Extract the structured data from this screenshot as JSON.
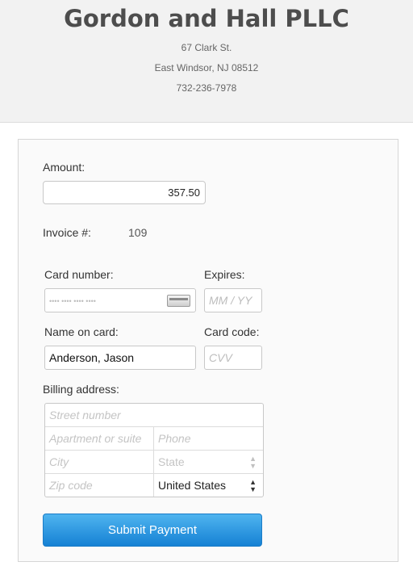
{
  "header": {
    "company": "Gordon and Hall PLLC",
    "street": "67 Clark St.",
    "city_line": "East Windsor, NJ 08512",
    "phone": "732-236-7978"
  },
  "form": {
    "amount_label": "Amount:",
    "amount_value": "357.50",
    "invoice_label": "Invoice #:",
    "invoice_value": "109",
    "card_number_label": "Card number:",
    "card_number_placeholder": "•••• •••• •••• ••••",
    "expires_label": "Expires:",
    "expires_placeholder": "MM / YY",
    "name_label": "Name on card:",
    "name_value": "Anderson, Jason",
    "card_code_label": "Card code:",
    "cvv_placeholder": "CVV",
    "billing_label": "Billing address:",
    "street_placeholder": "Street number",
    "apt_placeholder": "Apartment or suite",
    "phone_placeholder": "Phone",
    "city_placeholder": "City",
    "state_placeholder": "State",
    "zip_placeholder": "Zip code",
    "country_value": "United States",
    "submit_label": "Submit Payment"
  },
  "colors": {
    "accent": "#1a8fe0",
    "header_bg": "#f2f2f2"
  }
}
